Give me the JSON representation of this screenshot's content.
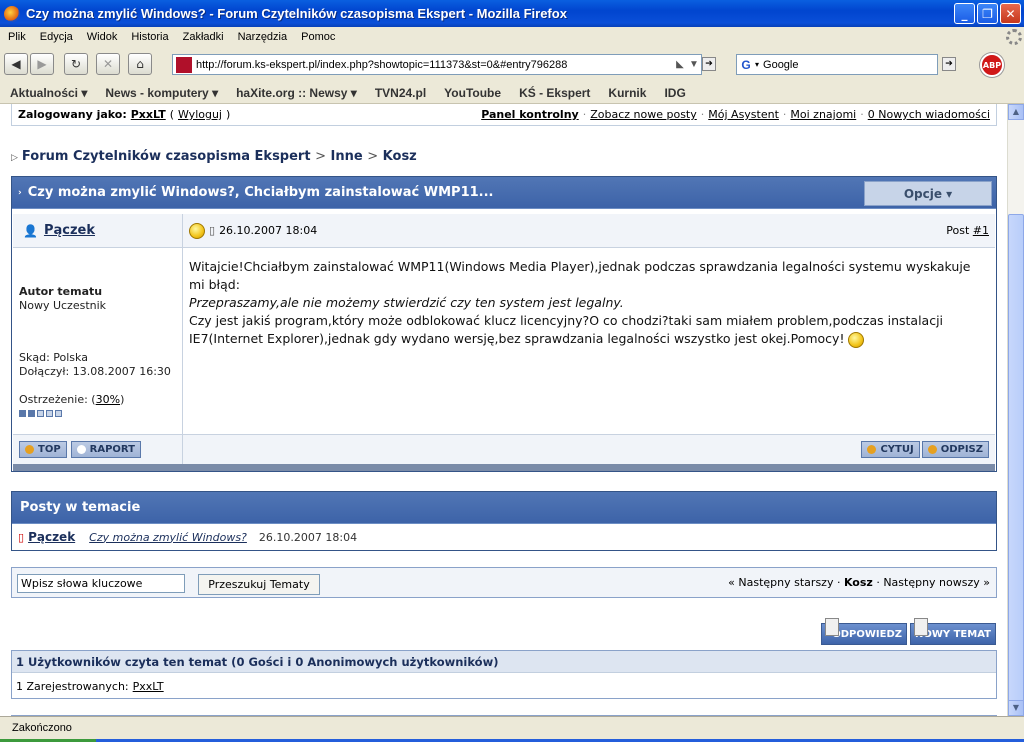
{
  "window": {
    "title": "Czy można zmylić Windows? - Forum Czytelników czasopisma Ekspert - Mozilla Firefox"
  },
  "menu": [
    "Plik",
    "Edycja",
    "Widok",
    "Historia",
    "Zakładki",
    "Narzędzia",
    "Pomoc"
  ],
  "nav": {
    "url": "http://forum.ks-ekspert.pl/index.php?showtopic=111373&st=0&#entry796288",
    "search_value": "Google"
  },
  "bookmarks": [
    "Aktualności ▾",
    "News - komputery ▾",
    "haXite.org :: Newsy ▾",
    "TVN24.pl",
    "YouToube",
    "KŚ - Ekspert",
    "Kurnik",
    "IDG"
  ],
  "userbar": {
    "logged_label": "Zalogowany jako:",
    "user": "PxxLT",
    "logout": "Wyloguj",
    "paren_open": "(",
    "paren_close": ")",
    "links": [
      "Panel kontrolny",
      "Zobacz nowe posty",
      "Mój Asystent",
      "Moi znajomi",
      "0 Nowych wiadomości"
    ]
  },
  "breadcrumb": {
    "items": [
      "Forum Czytelników czasopisma Ekspert",
      "Inne",
      "Kosz"
    ],
    "sep": ">"
  },
  "topic": {
    "title": "Czy można zmylić Windows?, Chciałbym zainstalować WMP11...",
    "options": "Opcje ▾"
  },
  "post": {
    "author": "Pączek",
    "date": "26.10.2007 18:04",
    "post_label": "Post",
    "post_num": "#1",
    "author_role": "Autor tematu",
    "author_rank": "Nowy Uczestnik",
    "from": "Skąd: Polska",
    "joined": "Dołączył: 13.08.2007 16:30",
    "warn_label": "Ostrzeżenie:",
    "warn_value": "30%",
    "warn_level": 0.3,
    "body_1": "Witajcie!Chciałbym zainstalować WMP11(Windows Media Player),jednak podczas sprawdzania legalności systemu wyskakuje mi błąd:",
    "body_2": "Przepraszamy,ale nie możemy stwierdzić czy ten system jest legalny.",
    "body_3": "Czy jest jakiś program,który może odblokować klucz licencyjny?O co chodzi?taki sam miałem problem,podczas instalacji IE7(Internet Explorer),jednak gdy wydano wersję,bez sprawdzania legalności wszystko jest okej.Pomocy!",
    "btn_top": "TOP",
    "btn_report": "RAPORT",
    "btn_quote": "CYTUJ",
    "btn_reply": "ODPISZ"
  },
  "posts_in_topic": {
    "header": "Posty w temacie",
    "author": "Pączek",
    "title": "Czy można zmylić Windows?",
    "date": "26.10.2007 18:04"
  },
  "search": {
    "placeholder": "Wpisz słowa kluczowe",
    "button": "Przeszukuj Tematy",
    "older": "« Następny starszy",
    "current": "Kosz",
    "newer": "Następny nowszy »",
    "sep": "·"
  },
  "actions": {
    "reply": "ODPOWIEDZ",
    "new_topic": "NOWY TEMAT"
  },
  "readers": {
    "header": "1 Użytkowników czyta ten temat (0 Gości i 0 Anonimowych użytkowników)",
    "registered_label": "1 Zarejestrowanych:",
    "user": "PxxLT"
  },
  "status": {
    "text": "Zakończono"
  }
}
